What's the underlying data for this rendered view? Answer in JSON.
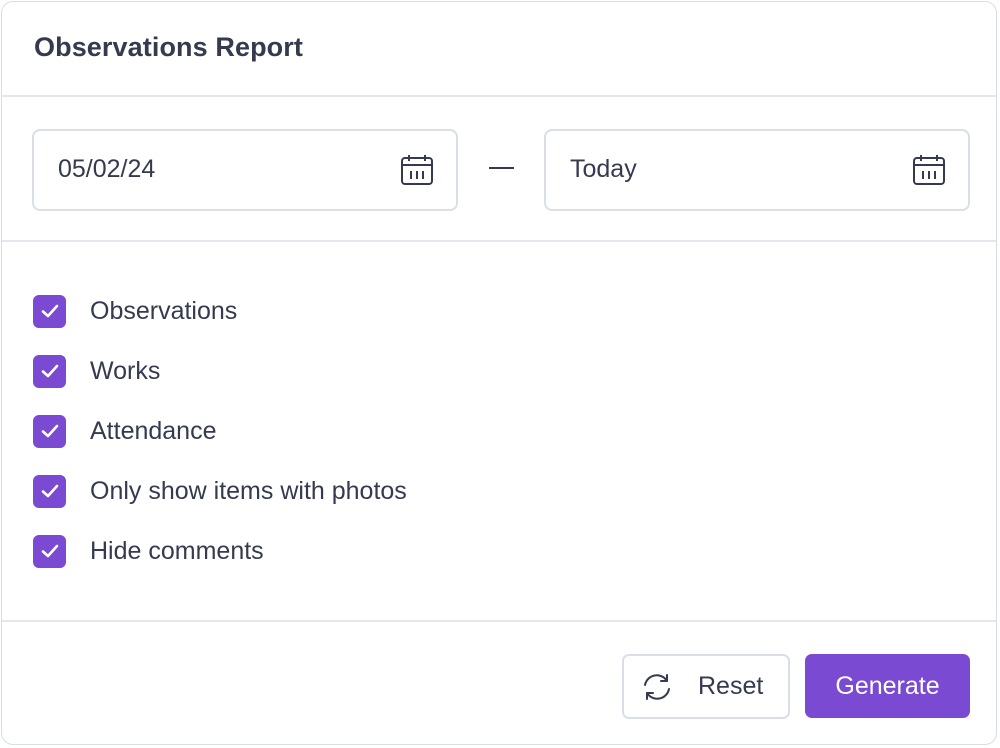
{
  "dialog": {
    "title": "Observations Report"
  },
  "date_range": {
    "start": {
      "value": "05/02/24",
      "icon": "calendar-icon"
    },
    "separator": "—",
    "end": {
      "value": "Today",
      "icon": "calendar-icon"
    }
  },
  "options": [
    {
      "label": "Observations",
      "checked": true
    },
    {
      "label": "Works",
      "checked": true
    },
    {
      "label": "Attendance",
      "checked": true
    },
    {
      "label": "Only show items with photos",
      "checked": true
    },
    {
      "label": "Hide comments",
      "checked": true
    }
  ],
  "footer": {
    "reset_label": "Reset",
    "reset_icon": "refresh-icon",
    "generate_label": "Generate"
  },
  "colors": {
    "accent": "#7a4ad3",
    "text": "#353a4f",
    "border": "#dadfe7"
  }
}
